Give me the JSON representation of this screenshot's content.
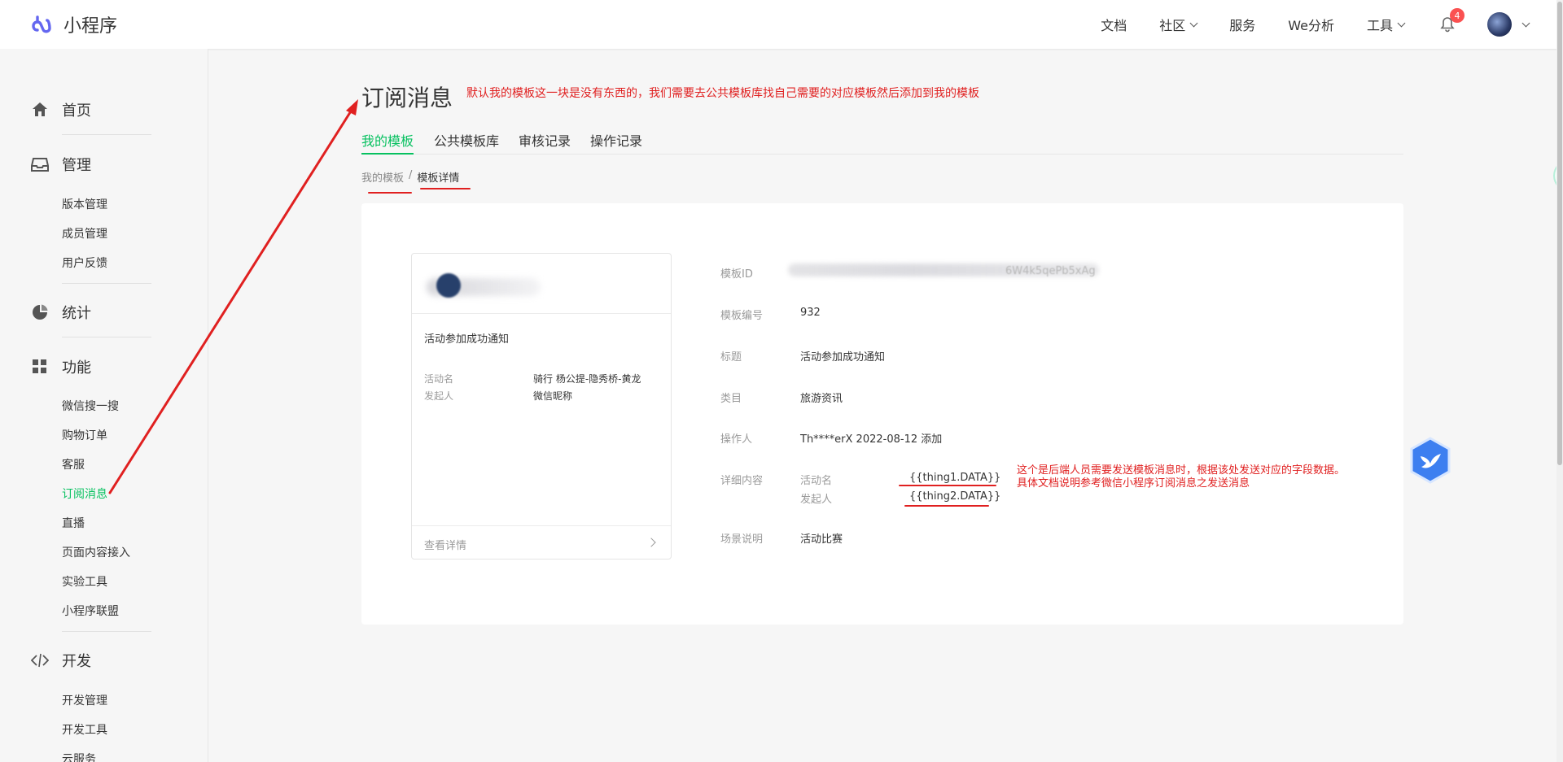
{
  "topbar": {
    "brand": "小程序",
    "nav": [
      {
        "label": "文档",
        "dropdown": false
      },
      {
        "label": "社区",
        "dropdown": true
      },
      {
        "label": "服务",
        "dropdown": false
      },
      {
        "label": "We分析",
        "dropdown": false
      },
      {
        "label": "工具",
        "dropdown": true
      }
    ],
    "notification_count": "4"
  },
  "sidebar": {
    "sections": [
      {
        "label": "首页",
        "icon": "home-icon"
      },
      {
        "label": "管理",
        "icon": "inbox-icon",
        "items": [
          "版本管理",
          "成员管理",
          "用户反馈"
        ]
      },
      {
        "label": "统计",
        "icon": "pie-chart-icon"
      },
      {
        "label": "功能",
        "icon": "grid-icon",
        "items": [
          "微信搜一搜",
          "购物订单",
          "客服",
          "订阅消息",
          "直播",
          "页面内容接入",
          "实验工具",
          "小程序联盟"
        ]
      },
      {
        "label": "开发",
        "icon": "code-icon",
        "items": [
          "开发管理",
          "开发工具",
          "云服务"
        ]
      }
    ],
    "active_item": "订阅消息"
  },
  "main": {
    "title": "订阅消息",
    "annotation_top": "默认我的模板这一块是没有东西的，我们需要去公共模板库找自己需要的对应模板然后添加到我的模板",
    "tabs": [
      "我的模板",
      "公共模板库",
      "审核记录",
      "操作记录"
    ],
    "active_tab": "我的模板",
    "breadcrumb": {
      "parent": "我的模板",
      "separator": "/",
      "current": "模板详情"
    },
    "preview": {
      "title": "活动参加成功通知",
      "rows": [
        {
          "key": "活动名",
          "value": "骑行 杨公提-隐秀桥-黄龙"
        },
        {
          "key": "发起人",
          "value": "微信昵称"
        }
      ],
      "more": "查看详情"
    },
    "details": {
      "template_id_label": "模板ID",
      "template_id_visible_tail": "6W4k5qePb5xAg",
      "number_label": "模板编号",
      "number": "932",
      "title_label": "标题",
      "title": "活动参加成功通知",
      "category_label": "类目",
      "category": "旅游资讯",
      "operator_label": "操作人",
      "operator": "Th****erX 2022-08-12 添加",
      "content_label": "详细内容",
      "fields": [
        {
          "name": "活动名",
          "value": "{{thing1.DATA}}"
        },
        {
          "name": "发起人",
          "value": "{{thing2.DATA}}"
        }
      ],
      "scene_label": "场景说明",
      "scene": "活动比赛"
    },
    "annotation_right": [
      "这个是后端人员需要发送模板消息时，根据该处发送对应的字段数据。",
      "具体文档说明参考微信小程序订阅消息之发送消息"
    ]
  },
  "colors": {
    "accent": "#07c160",
    "annotation": "#e02020",
    "badge": "#fa5151",
    "widget": "#3d7ff0"
  }
}
